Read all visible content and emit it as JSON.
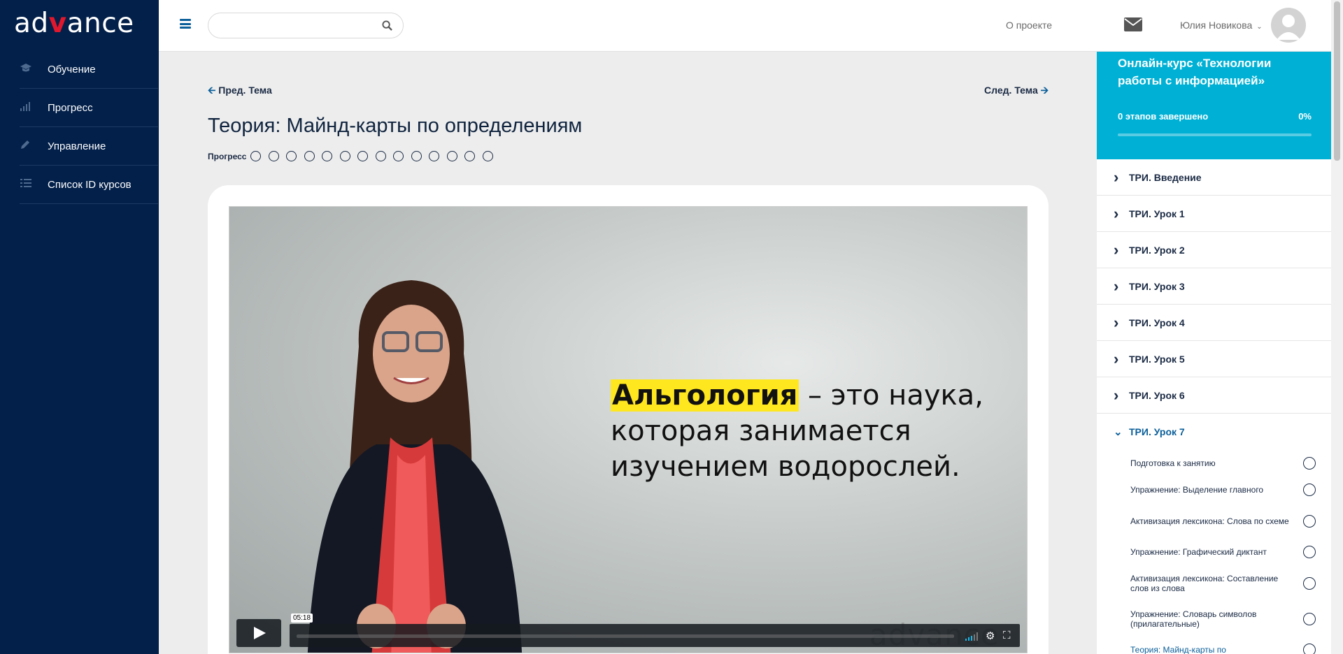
{
  "logo": {
    "part1": "ad",
    "check": "v",
    "part2": "ance"
  },
  "sidebar": {
    "items": [
      {
        "icon": "graduation-cap-icon",
        "label": "Обучение"
      },
      {
        "icon": "bar-chart-icon",
        "label": "Прогресс"
      },
      {
        "icon": "pencil-icon",
        "label": "Управление"
      },
      {
        "icon": "list-icon",
        "label": "Список ID курсов"
      }
    ]
  },
  "header": {
    "search_placeholder": "",
    "about": "О проекте",
    "user_name": "Юлия Новикова"
  },
  "main": {
    "prev": "Пред. Тема",
    "next": "След. Тема",
    "title": "Теория: Майнд-карты по определениям",
    "progress_label": "Прогресс",
    "progress_steps": 14,
    "progress_completed": 0
  },
  "video": {
    "highlight": "Альгология",
    "line1_rest": " – это наука,",
    "line2": "которая занимается",
    "line3": "изучением водорослей.",
    "watermark": "advance",
    "time": "05:18"
  },
  "course": {
    "title": "Онлайн-курс «Технологии работы с информацией»",
    "stages": "0 этапов завершено",
    "percent": "0%",
    "progress": 0,
    "sections": [
      "ТРИ. Введение",
      "ТРИ. Урок 1",
      "ТРИ. Урок 2",
      "ТРИ. Урок 3",
      "ТРИ. Урок 4",
      "ТРИ. Урок 5",
      "ТРИ. Урок 6"
    ],
    "open_section": "ТРИ. Урок 7",
    "lessons": [
      "Подготовка к занятию",
      "Упражнение: Выделение главного",
      "Активизация лексикона: Слова по схеме",
      "Упражнение: Графический диктант",
      "Активизация лексикона: Составление слов из слова",
      "Упражнение: Словарь символов (прилагательные)",
      "Теория: Майнд-карты по"
    ]
  },
  "colors": {
    "sidebar": "#03204a",
    "accent": "#00b1d5",
    "link": "#0b5f9a",
    "logo_check": "#e1182d",
    "highlight": "#ffe71f"
  }
}
